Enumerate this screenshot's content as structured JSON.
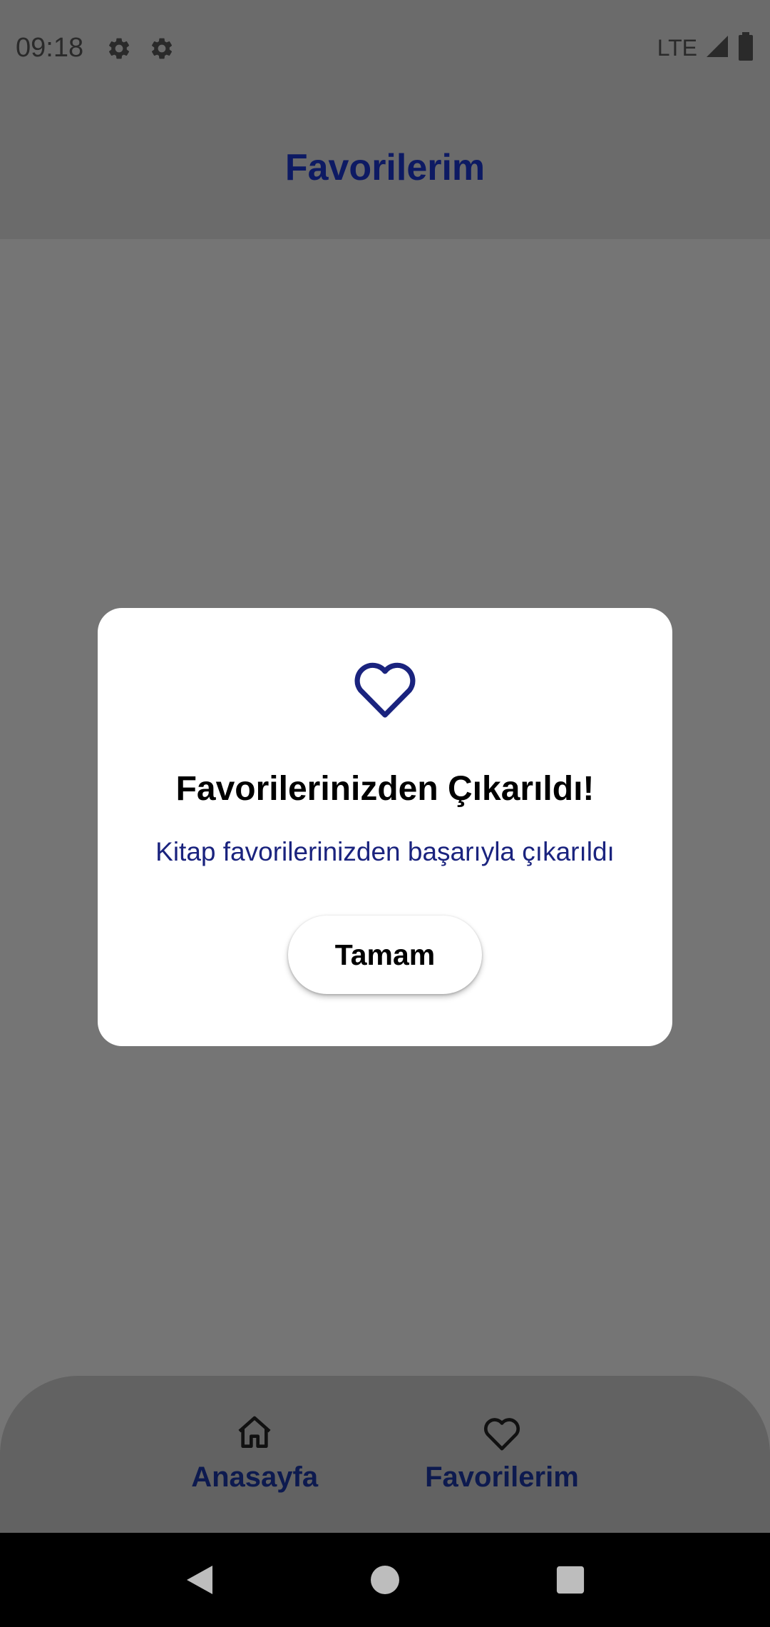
{
  "status_bar": {
    "time": "09:18",
    "network": "LTE",
    "icons": [
      "settings-gear-icon",
      "settings-gear-icon",
      "signal-icon",
      "battery-icon"
    ]
  },
  "app_bar": {
    "title": "Favorilerim"
  },
  "dialog": {
    "icon": "heart-outline-icon",
    "title": "Favorilerinizden Çıkarıldı!",
    "message": "Kitap favorilerinizden başarıyla çıkarıldı",
    "button_label": "Tamam"
  },
  "bottom_nav": {
    "items": [
      {
        "label": "Anasayfa",
        "icon": "home-icon"
      },
      {
        "label": "Favorilerim",
        "icon": "heart-outline-icon"
      }
    ]
  },
  "system_nav": {
    "icons": [
      "back-icon",
      "home-circle-icon",
      "recents-icon"
    ]
  },
  "colors": {
    "primary_navy": "#0d1a63",
    "message_blue": "#1a237e",
    "scrim_gray": "#757575",
    "dialog_bg": "#ffffff"
  }
}
